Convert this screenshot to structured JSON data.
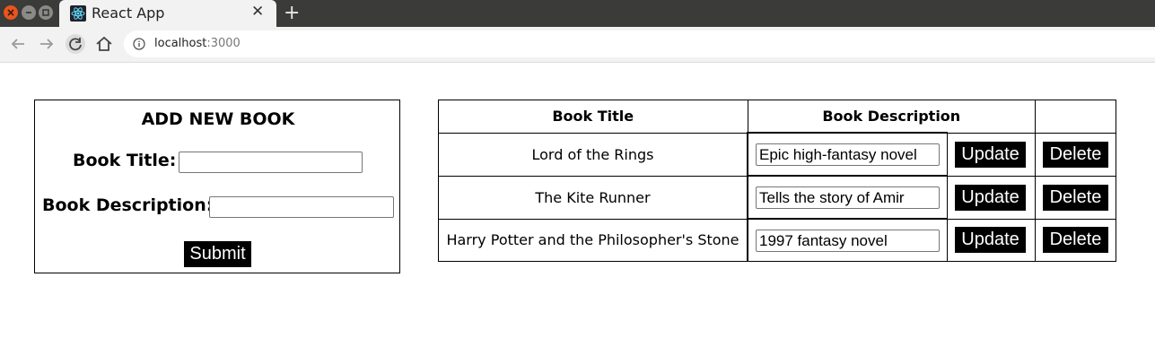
{
  "browser": {
    "tab_title": "React App",
    "tab_close": "✕",
    "new_tab": "+",
    "url_host": "localhost",
    "url_port": ":3000"
  },
  "form": {
    "heading": "ADD NEW BOOK",
    "title_label": "Book Title:",
    "title_value": "",
    "description_label": "Book Description:",
    "description_value": "",
    "submit_label": "Submit"
  },
  "table": {
    "headers": [
      "Book Title",
      "Book Description",
      ""
    ],
    "rows": [
      {
        "title": "Lord of the Rings",
        "description": "Epic high-fantasy novel",
        "update": "Update",
        "delete": "Delete"
      },
      {
        "title": "The Kite Runner",
        "description": "Tells the story of Amir",
        "update": "Update",
        "delete": "Delete"
      },
      {
        "title": "Harry Potter and the Philosopher's Stone",
        "description": "1997 fantasy novel",
        "update": "Update",
        "delete": "Delete"
      }
    ]
  },
  "icons": {
    "window_close": "close-icon",
    "tab_favicon": "react-logo-icon",
    "back": "arrow-left-icon",
    "forward": "arrow-right-icon",
    "reload": "reload-icon",
    "home": "home-icon",
    "site_info": "info-icon"
  },
  "colors": {
    "titlebar": "#3b3b39",
    "close_button": "#e9541f",
    "button_bg": "#000000",
    "button_text": "#ffffff",
    "react_blue": "#61dafb"
  }
}
